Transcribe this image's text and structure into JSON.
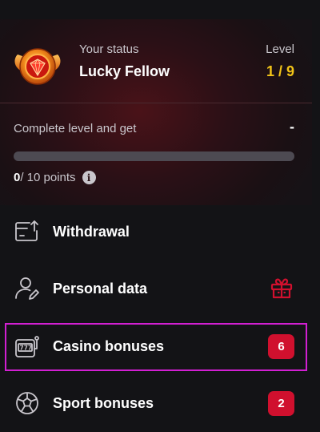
{
  "status": {
    "caption": "Your status",
    "name": "Lucky Fellow",
    "level_caption": "Level",
    "level_value": "1 / 9",
    "badge_icon": "winged-gem-badge-icon"
  },
  "progress": {
    "label": "Complete level and get",
    "reward": "-",
    "current": "0",
    "total_text": " / 10 points",
    "fraction": 0,
    "info_glyph": "i"
  },
  "menu": [
    {
      "label": "Withdrawal",
      "icon": "withdrawal-icon"
    },
    {
      "label": "Personal data",
      "icon": "user-edit-icon",
      "extra_icon": "gift-icon"
    },
    {
      "label": "Casino bonuses",
      "icon": "slot-machine-icon",
      "badge": "6"
    },
    {
      "label": "Sport bonuses",
      "icon": "soccer-ball-icon",
      "badge": "2"
    }
  ],
  "colors": {
    "accent_yellow": "#f2c418",
    "badge_red": "#d0102e",
    "highlight_magenta": "#d21fd2"
  }
}
